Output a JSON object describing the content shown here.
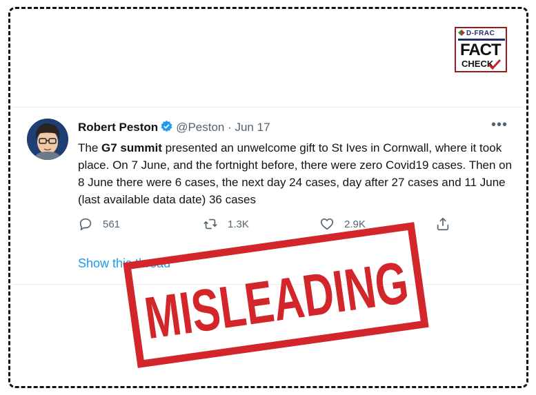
{
  "badge": {
    "brand": "D-FRAC",
    "fact": "FACT",
    "check": "CHECK",
    "colors": {
      "navy": "#1c2f6b",
      "red": "#c0282d",
      "green": "#2a8a3a"
    }
  },
  "tweet": {
    "author_name": "Robert Peston",
    "handle_date": "@Peston · Jun 17",
    "more": "•••",
    "text_pre": "The ",
    "text_bold": "G7 summit",
    "text_post": " presented an unwelcome gift to St Ives in Cornwall, where it took place.  On 7 June, and the fortnight before, there were zero Covid19 cases. Then on 8 June there were 6 cases, the next day 24 cases, day after 27 cases and 11 June (last available data date) 36 cases",
    "actions": {
      "replies": "561",
      "retweets": "1.3K",
      "likes": "2.9K"
    },
    "show_thread": "Show this thread"
  },
  "stamp": {
    "label": "MISLEADING",
    "color": "#d3262b"
  },
  "icons": [
    "d-frac-logo-icon",
    "verified-icon",
    "more-icon",
    "reply-icon",
    "retweet-icon",
    "like-icon",
    "share-icon",
    "check-icon"
  ]
}
